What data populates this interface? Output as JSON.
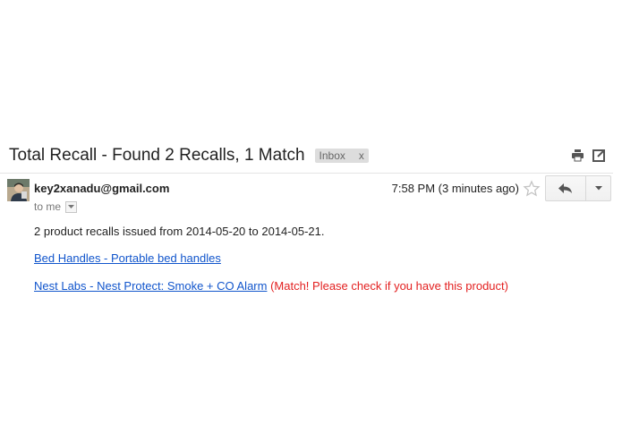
{
  "email": {
    "subject": "Total Recall - Found 2 Recalls, 1 Match",
    "label": "Inbox",
    "label_remove": "x",
    "sender": "key2xanadu@gmail.com",
    "recipient": "to me",
    "timestamp": "7:58 PM (3 minutes ago)",
    "body": {
      "intro": "2 product recalls issued from 2014-05-20 to 2014-05-21.",
      "links": [
        {
          "text": "Bed Handles - Portable bed handles"
        },
        {
          "text": "Nest Labs - Nest Protect: Smoke + CO Alarm",
          "note": "(Match! Please check if you have this product)"
        }
      ]
    }
  },
  "icons": {
    "print": "print-icon",
    "new_window": "new-window-icon",
    "star": "star-icon",
    "reply": "reply-icon",
    "more": "chevron-down-icon",
    "avatar": "avatar"
  },
  "colors": {
    "link": "#1155cc",
    "match_note": "#e32020",
    "label_chip": "#dddddd"
  }
}
